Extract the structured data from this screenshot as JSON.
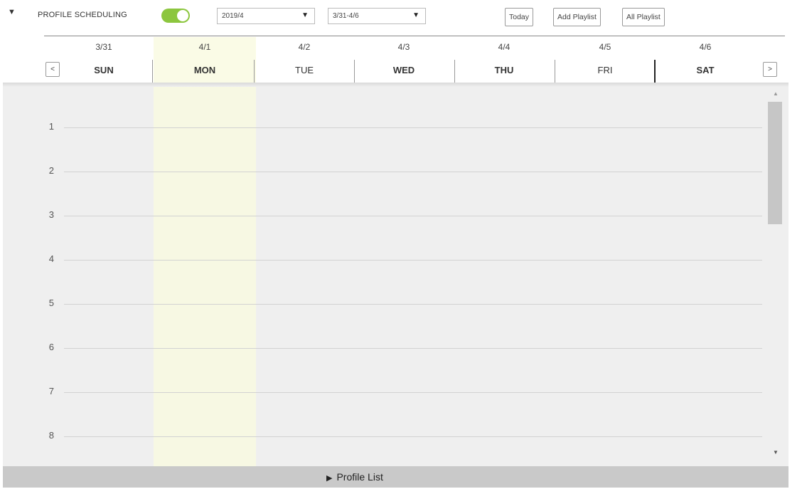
{
  "header": {
    "collapse_icon": "▼",
    "title": "PROFILE SCHEDULING",
    "toggle_on": true,
    "month_select": "2019/4",
    "week_select": "3/31-4/6",
    "select_arrow": "▼",
    "today_label": "Today",
    "add_playlist_label": "Add Playlist",
    "all_playlist_label": "All Playlist"
  },
  "week": {
    "prev_label": "<",
    "next_label": ">",
    "highlight_color": "#fafbe6",
    "days": [
      {
        "date": "3/31",
        "day": "SUN"
      },
      {
        "date": "4/1",
        "day": "MON"
      },
      {
        "date": "4/2",
        "day": "TUE"
      },
      {
        "date": "4/3",
        "day": "WED"
      },
      {
        "date": "4/4",
        "day": "THU"
      },
      {
        "date": "4/5",
        "day": "FRI"
      },
      {
        "date": "4/6",
        "day": "SAT"
      }
    ]
  },
  "hours": [
    "1",
    "2",
    "3",
    "4",
    "5",
    "6",
    "7",
    "8"
  ],
  "scrollbar": {
    "up_icon": "▲",
    "down_icon": "▼"
  },
  "footer": {
    "icon": "▶",
    "label": "Profile List"
  },
  "colors": {
    "toggle": "#8cc63e",
    "footer": "#c9c9c9",
    "grid_bg": "#efefef"
  }
}
